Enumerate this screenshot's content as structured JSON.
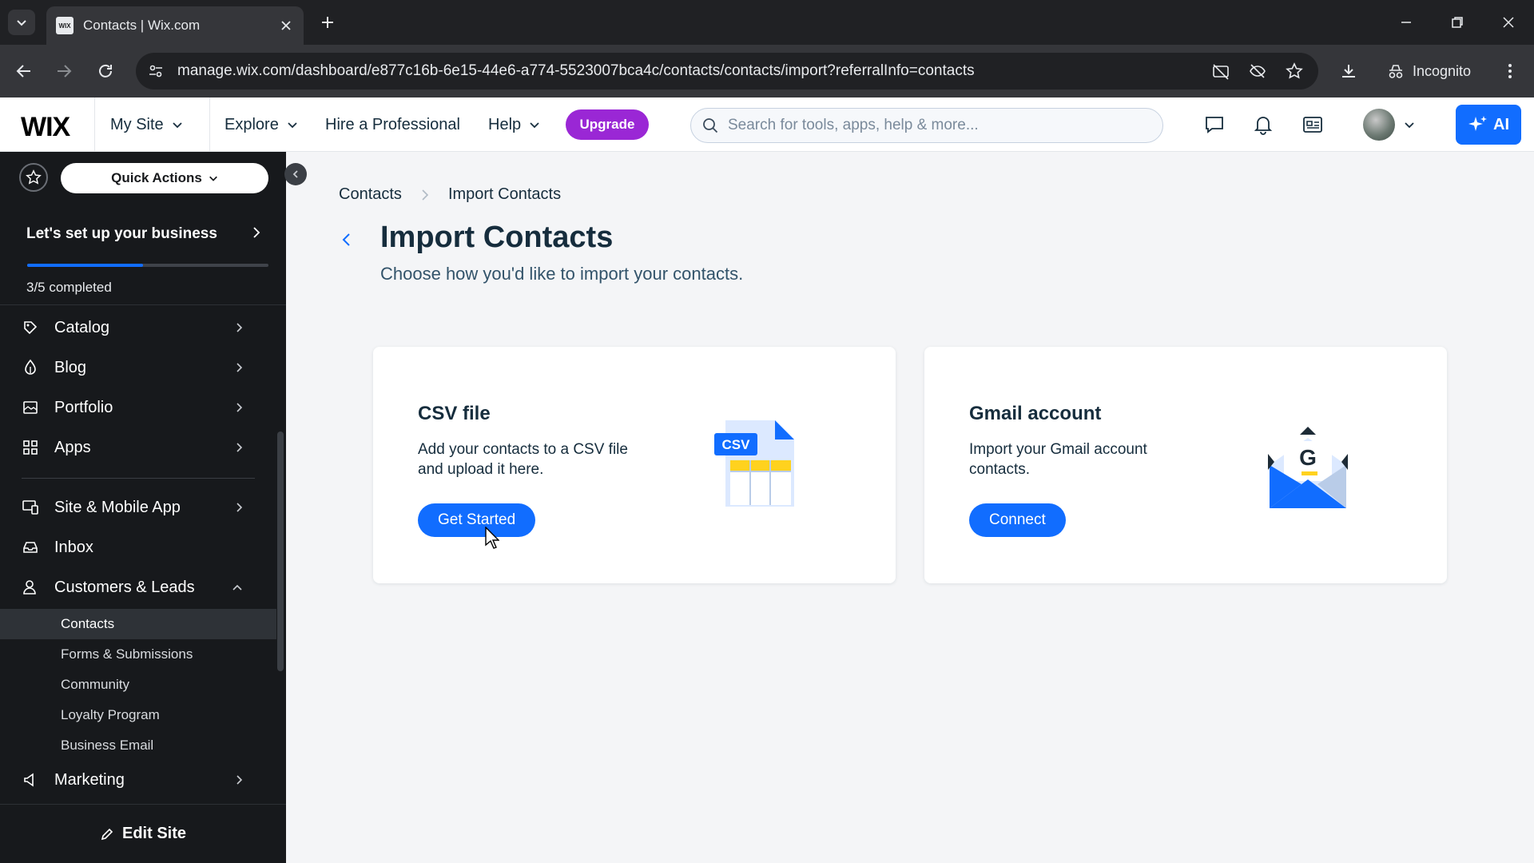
{
  "browser": {
    "tab_title": "Contacts | Wix.com",
    "favicon_text": "WIX",
    "url": "manage.wix.com/dashboard/e877c16b-6e15-44e6-a774-5523007bca4c/contacts/contacts/import?referralInfo=contacts",
    "incognito_label": "Incognito"
  },
  "topbar": {
    "logo": "WIX",
    "my_site": "My Site",
    "explore": "Explore",
    "hire": "Hire a Professional",
    "help": "Help",
    "upgrade": "Upgrade",
    "search_placeholder": "Search for tools, apps, help & more...",
    "ai_label": "AI"
  },
  "sidebar": {
    "quick_actions": "Quick Actions",
    "setup": {
      "title": "Let's set up your business",
      "progress_text": "3/5 completed",
      "progress_fraction": 0.48
    },
    "items": [
      {
        "label": "Catalog",
        "icon": "catalog-icon"
      },
      {
        "label": "Blog",
        "icon": "blog-icon"
      },
      {
        "label": "Portfolio",
        "icon": "portfolio-icon"
      },
      {
        "label": "Apps",
        "icon": "apps-icon"
      },
      {
        "label": "Site & Mobile App",
        "icon": "site-mobile-icon"
      },
      {
        "label": "Inbox",
        "icon": "inbox-icon"
      },
      {
        "label": "Customers & Leads",
        "icon": "customers-icon"
      },
      {
        "label": "Marketing",
        "icon": "marketing-icon"
      }
    ],
    "sub_items": [
      {
        "label": "Contacts",
        "active": true
      },
      {
        "label": "Forms & Submissions"
      },
      {
        "label": "Community"
      },
      {
        "label": "Loyalty Program"
      },
      {
        "label": "Business Email"
      }
    ],
    "edit_site": "Edit Site"
  },
  "main": {
    "breadcrumb": [
      "Contacts",
      "Import Contacts"
    ],
    "title": "Import Contacts",
    "subtitle": "Choose how you'd like to import your contacts.",
    "cards": [
      {
        "title": "CSV file",
        "description": "Add your contacts to a CSV file and upload it here.",
        "button": "Get Started",
        "badge": "CSV",
        "icon": "csv-file-icon"
      },
      {
        "title": "Gmail account",
        "description": "Import your Gmail account contacts.",
        "button": "Connect",
        "badge": "G",
        "icon": "gmail-envelope-icon"
      }
    ]
  },
  "colors": {
    "accent": "#116DFF",
    "upgrade": "#9A27D5",
    "sidebar_bg": "#17191C",
    "page_bg": "#F4F5F7"
  }
}
